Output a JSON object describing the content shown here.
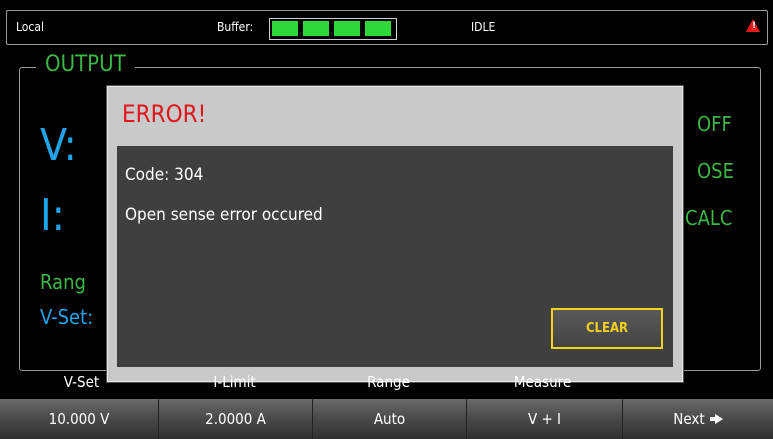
{
  "status_bar": {
    "mode": "Local",
    "buffer_label": "Buffer:",
    "buffer_segments": 4,
    "state": "IDLE",
    "warning_icon": "warning-triangle-icon"
  },
  "output": {
    "title": "OUTPUT",
    "v_label": "V:",
    "i_label": "I:",
    "range_partial": "Rang",
    "vset_partial": "V-Set:",
    "indicators": [
      "OFF",
      "OSE",
      "CALC"
    ]
  },
  "dialog": {
    "title": "ERROR!",
    "code_line": "Code: 304",
    "message": "Open sense error occured",
    "clear_button": "CLEAR"
  },
  "softkey_labels": [
    "V-Set",
    "I-Limit",
    "Range",
    "Measure"
  ],
  "softkeys": [
    "10.000 V",
    "2.0000 A",
    "Auto",
    "V + I",
    "Next"
  ],
  "colors": {
    "green": "#3cb846",
    "blue": "#1fa4e8",
    "error_red": "#e3141b",
    "clear_yellow": "#f2cf1a"
  }
}
